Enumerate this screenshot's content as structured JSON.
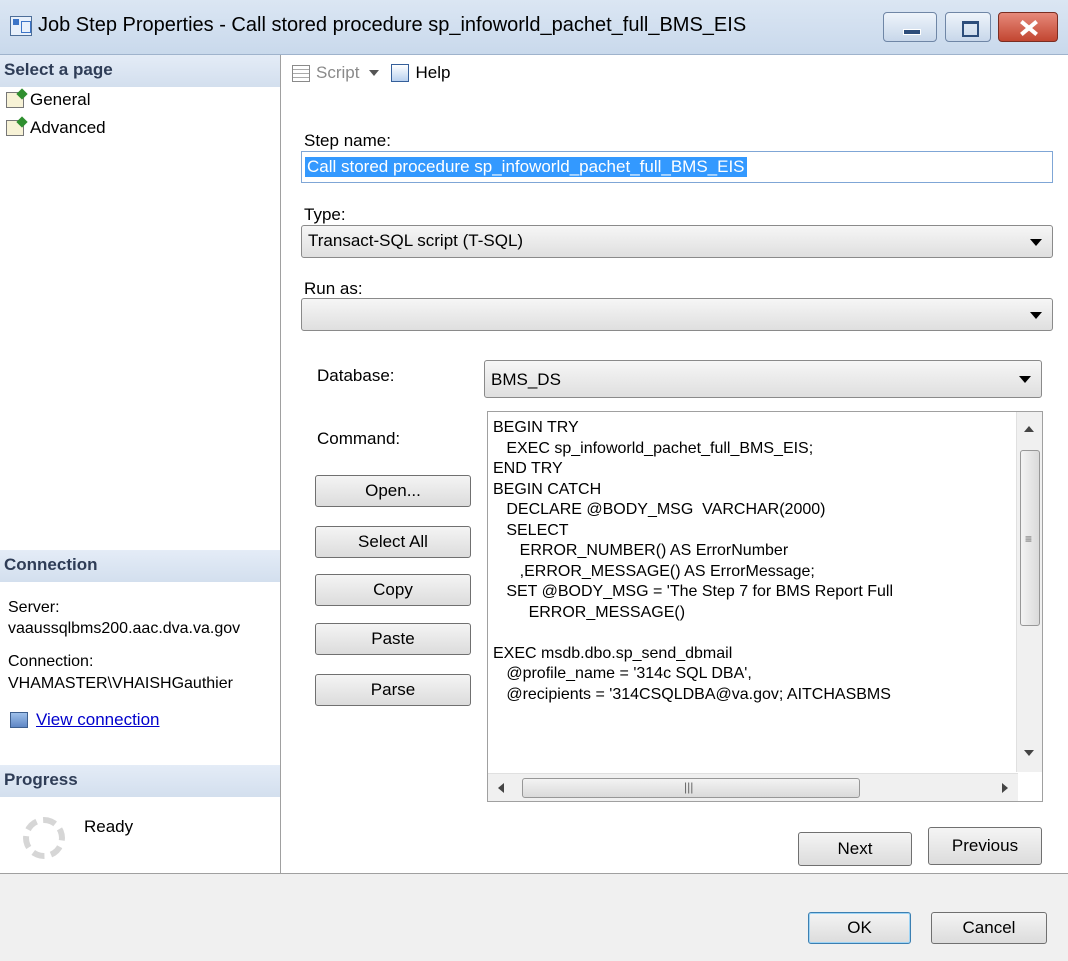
{
  "window": {
    "title": "Job Step Properties - Call stored procedure sp_infoworld_pachet_full_BMS_EIS"
  },
  "sidebar": {
    "select_page_header": "Select a page",
    "pages": [
      {
        "label": "General",
        "icon": "properties-icon"
      },
      {
        "label": "Advanced",
        "icon": "properties-icon"
      }
    ],
    "connection_header": "Connection",
    "server_label": "Server:",
    "server_value": "vaaussqlbms200.aac.dva.va.gov",
    "connection_label": "Connection:",
    "connection_value": "VHAMASTER\\VHAISHGauthier",
    "view_connection": "View connection",
    "progress_header": "Progress",
    "progress_status": "Ready"
  },
  "toolbar": {
    "script_label": "Script",
    "help_label": "Help"
  },
  "form": {
    "step_name_label": "Step name:",
    "step_name_value": "Call stored procedure sp_infoworld_pachet_full_BMS_EIS",
    "type_label": "Type:",
    "type_value": "Transact-SQL script (T-SQL)",
    "run_as_label": "Run as:",
    "run_as_value": "",
    "database_label": "Database:",
    "database_value": "BMS_DS",
    "command_label": "Command:",
    "command_text": "BEGIN TRY\n   EXEC sp_infoworld_pachet_full_BMS_EIS;\nEND TRY\nBEGIN CATCH\n   DECLARE @BODY_MSG  VARCHAR(2000)\n   SELECT\n      ERROR_NUMBER() AS ErrorNumber\n      ,ERROR_MESSAGE() AS ErrorMessage;\n   SET @BODY_MSG = 'The Step 7 for BMS Report Full\n        ERROR_MESSAGE()\n\nEXEC msdb.dbo.sp_send_dbmail\n   @profile_name = '314c SQL DBA',\n   @recipients = '314CSQLDBA@va.gov; AITCHASBMS"
  },
  "command_buttons": {
    "open": "Open...",
    "select_all": "Select All",
    "copy": "Copy",
    "paste": "Paste",
    "parse": "Parse"
  },
  "nav_buttons": {
    "next": "Next",
    "previous": "Previous"
  },
  "dialog_buttons": {
    "ok": "OK",
    "cancel": "Cancel"
  }
}
